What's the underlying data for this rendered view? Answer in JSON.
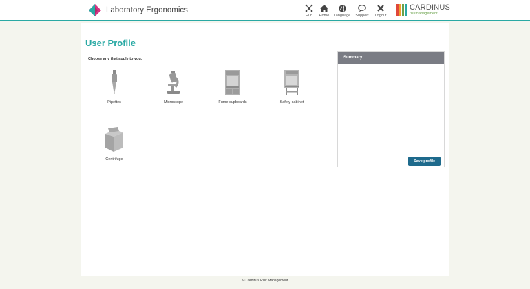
{
  "header": {
    "app_title": "Laboratory Ergonomics",
    "nav": [
      {
        "label": "Hub",
        "icon": "hub-icon"
      },
      {
        "label": "Home",
        "icon": "home-icon"
      },
      {
        "label": "Language",
        "icon": "globe-icon"
      },
      {
        "label": "Support",
        "icon": "chat-icon"
      },
      {
        "label": "Logout",
        "icon": "close-icon"
      }
    ],
    "partner_logo": {
      "name": "CARDINUS",
      "sub": "riskmanagement",
      "colors": [
        "#e0483a",
        "#f0a030",
        "#6aa24a",
        "#2aa9a4"
      ]
    }
  },
  "main": {
    "title": "User Profile",
    "instruction": "Choose any that apply to you:",
    "equipment": [
      {
        "label": "Pipettes",
        "icon": "pipette-icon"
      },
      {
        "label": "Microscope",
        "icon": "microscope-icon"
      },
      {
        "label": "Fume cupboards",
        "icon": "fume-cupboard-icon"
      },
      {
        "label": "Safety cabinet",
        "icon": "safety-cabinet-icon"
      },
      {
        "label": "Centrifuge",
        "icon": "centrifuge-icon"
      }
    ]
  },
  "summary": {
    "heading": "Summary",
    "save_label": "Save profile"
  },
  "footer": {
    "text": "© Cardinus Risk Management"
  },
  "colors": {
    "accent": "#2aa9a4",
    "button": "#1e6a8c",
    "summary_header": "#7a7c84"
  }
}
